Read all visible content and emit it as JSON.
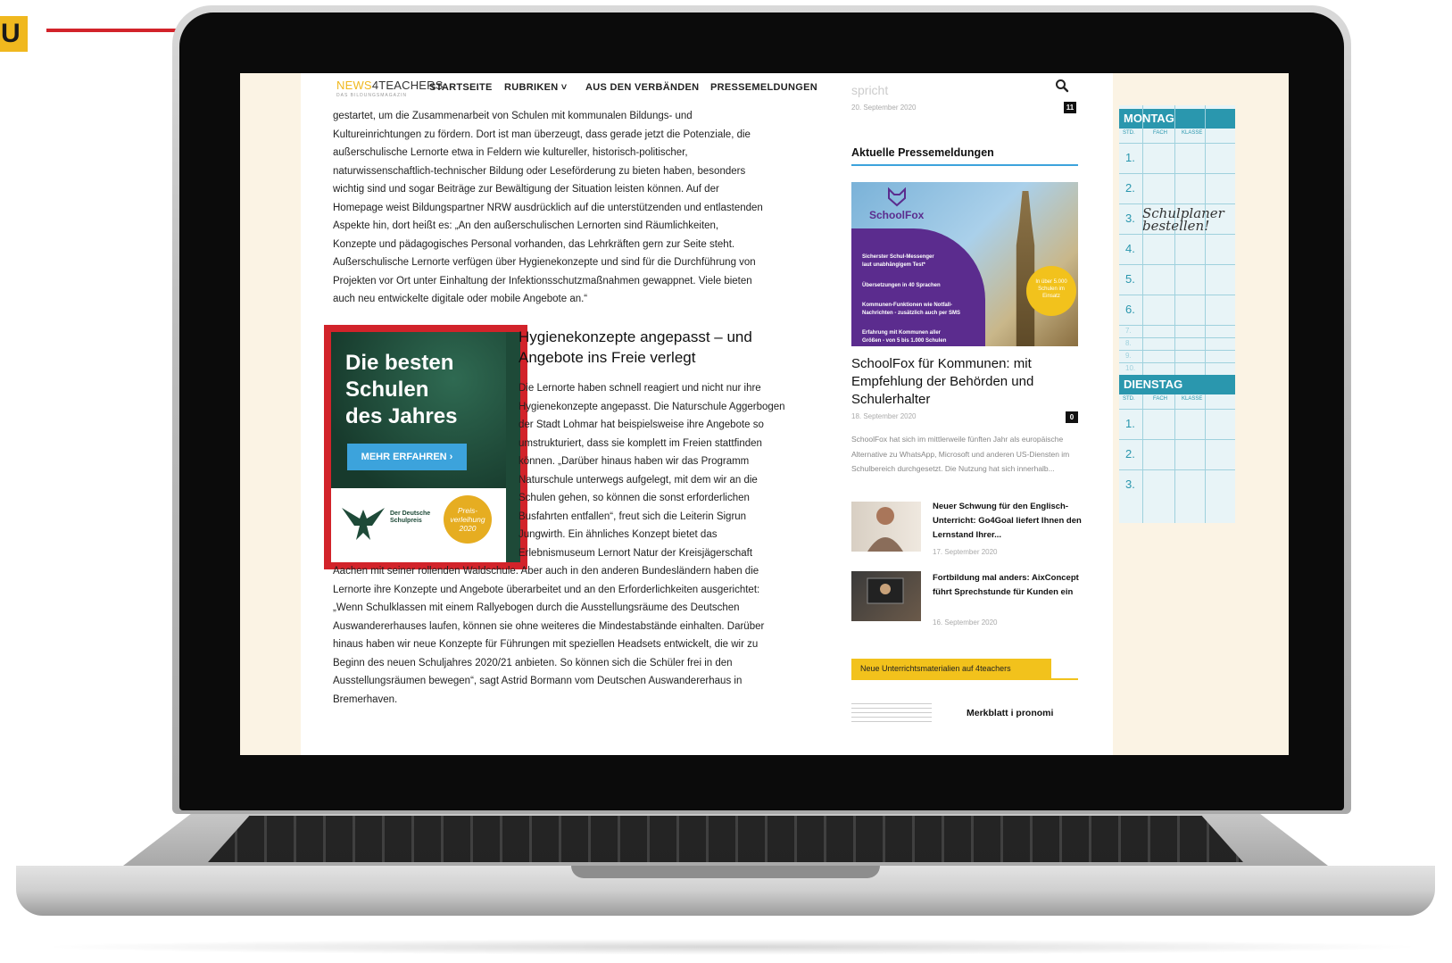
{
  "callout": {
    "badge": "U"
  },
  "site": {
    "logo_yellow": "NEWS",
    "logo_dark": "4TEACHERS",
    "logo_sub": "DAS BILDUNGSMAGAZIN",
    "nav": [
      "STARTSEITE",
      "RUBRIKEN ˅",
      "AUS DEN VERBÄNDEN",
      "PRESSEMELDUNGEN"
    ]
  },
  "article": {
    "para1": [
      "gestartet, um die Zusammenarbeit von Schulen mit kommunalen Bildungs- und",
      "Kultureinrichtungen zu fördern. Dort ist man überzeugt, dass gerade jetzt die Potenziale, die",
      "außerschulische Lernorte etwa in Feldern wie kultureller, historisch-politischer,",
      "naturwissenschaftlich-technischer Bildung oder Leseförderung zu bieten haben, besonders",
      "wichtig sind und sogar Beiträge zur Bewältigung der Situation leisten können. Auf der",
      "Homepage weist Bildungspartner NRW ausdrücklich auf die unterstützenden und entlastenden",
      "Aspekte hin, dort heißt es: „An den außerschulischen Lernorten sind Räumlichkeiten,",
      "Konzepte und pädagogisches Personal vorhanden, das Lehrkräften gern zur Seite steht.",
      "Außerschulische Lernorte verfügen über Hygienekonzepte und sind für die Durchführung von",
      "Projekten vor Ort unter Einhaltung der Infektionsschutzmaßnahmen gewappnet. Viele bieten",
      "auch neu entwickelte digitale oder mobile Angebote an.“"
    ],
    "heading_line1": "Hygienekonzepte angepasst – und",
    "heading_line2": "Angebote ins Freie verlegt",
    "para2": [
      "Die Lernorte haben schnell reagiert und nicht nur ihre",
      "Hygienekonzepte angepasst. Die Naturschule Aggerbogen",
      "der Stadt Lohmar hat beispielsweise ihre Angebote so",
      "umstrukturiert, dass sie komplett im Freien stattfinden",
      "können. „Darüber hinaus haben wir das Programm",
      "Naturschule unterwegs aufgelegt, mit dem wir an die",
      "Schulen gehen, so können die sonst erforderlichen",
      "Busfahrten entfallen“, freut sich die Leiterin Sigrun",
      "Jungwirth. Ein ähnliches Konzept bietet das",
      "Erlebnismuseum Lernort Natur der Kreisjägerschaft"
    ],
    "para3": [
      "Aachen mit seiner rollenden Waldschule. Aber auch in den anderen Bundesländern haben die",
      "Lernorte ihre Konzepte und Angebote überarbeitet und an den Erforderlichkeiten ausgerichtet:",
      "„Wenn Schulklassen mit einem Rallyebogen durch die Ausstellungsräume des Deutschen",
      "Auswandererhauses laufen, können sie ohne weiteres die Mindestabstände einhalten. Darüber",
      "hinaus haben wir neue Konzepte für Führungen mit speziellen Headsets entwickelt, die wir zu",
      "Beginn des neuen Schuljahres 2020/21 anbieten. So können sich die Schüler frei in den",
      "Ausstellungsräumen bewegen“, sagt Astrid Bormann vom Deutschen Auswandererhaus in",
      "Bremerhaven."
    ]
  },
  "ad": {
    "title_lines": [
      "Die besten",
      "Schulen",
      "des Jahres"
    ],
    "button": "MEHR ERFAHREN ›",
    "brand_line1": "Der Deutsche",
    "brand_line2": "Schulpreis",
    "badge_lines": [
      "Preis-",
      "verleihung",
      "2020"
    ]
  },
  "sidebar": {
    "faded_text": "spricht",
    "faded_date": "20. September 2020",
    "faded_count": "11",
    "heading": "Aktuelle Pressemeldungen",
    "img_brand": "SchoolFox",
    "img_lines": [
      "Sicherster Schul-Messenger",
      "laut unabhängigem Test*",
      "Übersetzungen in 40 Sprachen",
      "Kommunen-Funktionen wie Notfall-",
      "Nachrichten - zusätzlich auch per SMS",
      "Erfahrung mit Kommunen aller",
      "Größen - von 5 bis 1.000 Schulen"
    ],
    "img_coin": [
      "In über 5.000",
      "Schulen im",
      "Einsatz"
    ],
    "main_title": "SchoolFox für Kommunen: mit Empfehlung der Behörden und Schulerhalter",
    "main_date": "18. September 2020",
    "main_count": "0",
    "main_excerpt": "SchoolFox hat sich im mittlerweile fünften Jahr als europäische Alternative zu WhatsApp, Microsoft und anderen US-Diensten im Schulbereich durchgesetzt. Die Nutzung hat sich innerhalb...",
    "items": [
      {
        "title": "Neuer Schwung für den Englisch-Unterricht: Go4Goal liefert Ihnen den Lernstand Ihrer...",
        "date": "17. September 2020"
      },
      {
        "title": "Fortbildung mal anders: AixConcept führt Sprechstunde für Kunden ein",
        "date": "16. September 2020"
      }
    ],
    "materials_label": "Neue Unterrichtsmaterialien auf 4teachers",
    "merkblatt": "Merkblatt i pronomi"
  },
  "planner": {
    "day1": "MONTAG",
    "day2": "DIENSTAG",
    "sub": [
      "STD.",
      "FACH",
      "KLASSE"
    ],
    "rows1": [
      "1.",
      "2.",
      "3.",
      "4.",
      "5.",
      "6."
    ],
    "rows1_small": [
      "7.",
      "8.",
      "9.",
      "10."
    ],
    "rows2": [
      "1.",
      "2.",
      "3."
    ],
    "note_line1": "Schulplaner",
    "note_line2": "bestellen!"
  },
  "colors": {
    "callout_red": "#d2232a",
    "accent_yellow": "#f0b81e",
    "link_blue": "#3ca3dc",
    "planner_teal": "#2a97ae"
  }
}
